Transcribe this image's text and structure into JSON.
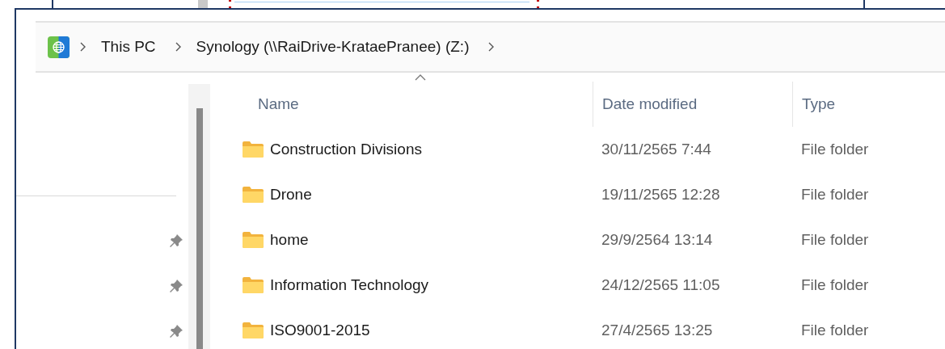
{
  "breadcrumb": {
    "items": [
      {
        "label": "This PC"
      },
      {
        "label": "Synology (\\\\RaiDrive-KrataePranee) (Z:)"
      }
    ]
  },
  "quick_access": [
    {
      "pinned": true
    },
    {
      "pinned": true
    },
    {
      "pinned": true
    }
  ],
  "file_list": {
    "columns": [
      {
        "label": "Name",
        "sorted": true
      },
      {
        "label": "Date modified",
        "sorted": false
      },
      {
        "label": "Type",
        "sorted": false
      }
    ],
    "rows": [
      {
        "name": "Construction Divisions",
        "date_modified": "30/11/2565 7:44",
        "type": "File folder"
      },
      {
        "name": "Drone",
        "date_modified": "19/11/2565 12:28",
        "type": "File folder"
      },
      {
        "name": "home",
        "date_modified": "29/9/2564 13:14",
        "type": "File folder"
      },
      {
        "name": "Information Technology",
        "date_modified": "24/12/2565 11:05",
        "type": "File folder"
      },
      {
        "name": "ISO9001-2015",
        "date_modified": "27/4/2565 13:25",
        "type": "File folder"
      }
    ]
  }
}
